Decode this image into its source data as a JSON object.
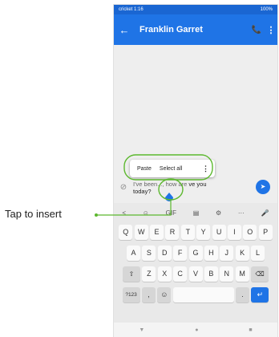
{
  "status_bar": {
    "carrier_time": "cricket 1:16",
    "battery": "100%"
  },
  "app_bar": {
    "back_icon": "←",
    "title": "Franklin Garret",
    "call_icon": "📞",
    "more_icon": "⋮"
  },
  "context_menu": {
    "paste": "Paste",
    "select_all": "Select all",
    "more_icon": "⋮"
  },
  "compose": {
    "attach_icon": "⊘",
    "message_line1": "ve you",
    "message_line1_faded": "I've been..., how are",
    "message_line2": "today?",
    "send_icon": "➤"
  },
  "keyboard": {
    "suggestions": [
      "<",
      "☺",
      "GIF",
      "▤",
      "⚙",
      "···",
      "🎤"
    ],
    "row1": [
      "Q",
      "W",
      "E",
      "R",
      "T",
      "Y",
      "U",
      "I",
      "O",
      "P"
    ],
    "row2": [
      "A",
      "S",
      "D",
      "F",
      "G",
      "H",
      "J",
      "K",
      "L"
    ],
    "row3": [
      "Z",
      "X",
      "C",
      "V",
      "B",
      "N",
      "M"
    ],
    "shift_icon": "⇧",
    "backspace_icon": "⌫",
    "numbers_label": "?123",
    "comma": ",",
    "emoji_icon": "☺",
    "period": ".",
    "enter_icon": "↵"
  },
  "nav_bar": {
    "back": "▼",
    "home": "●",
    "recents": "■"
  },
  "callout": {
    "text": "Tap to insert",
    "color": "#5cb82e"
  }
}
